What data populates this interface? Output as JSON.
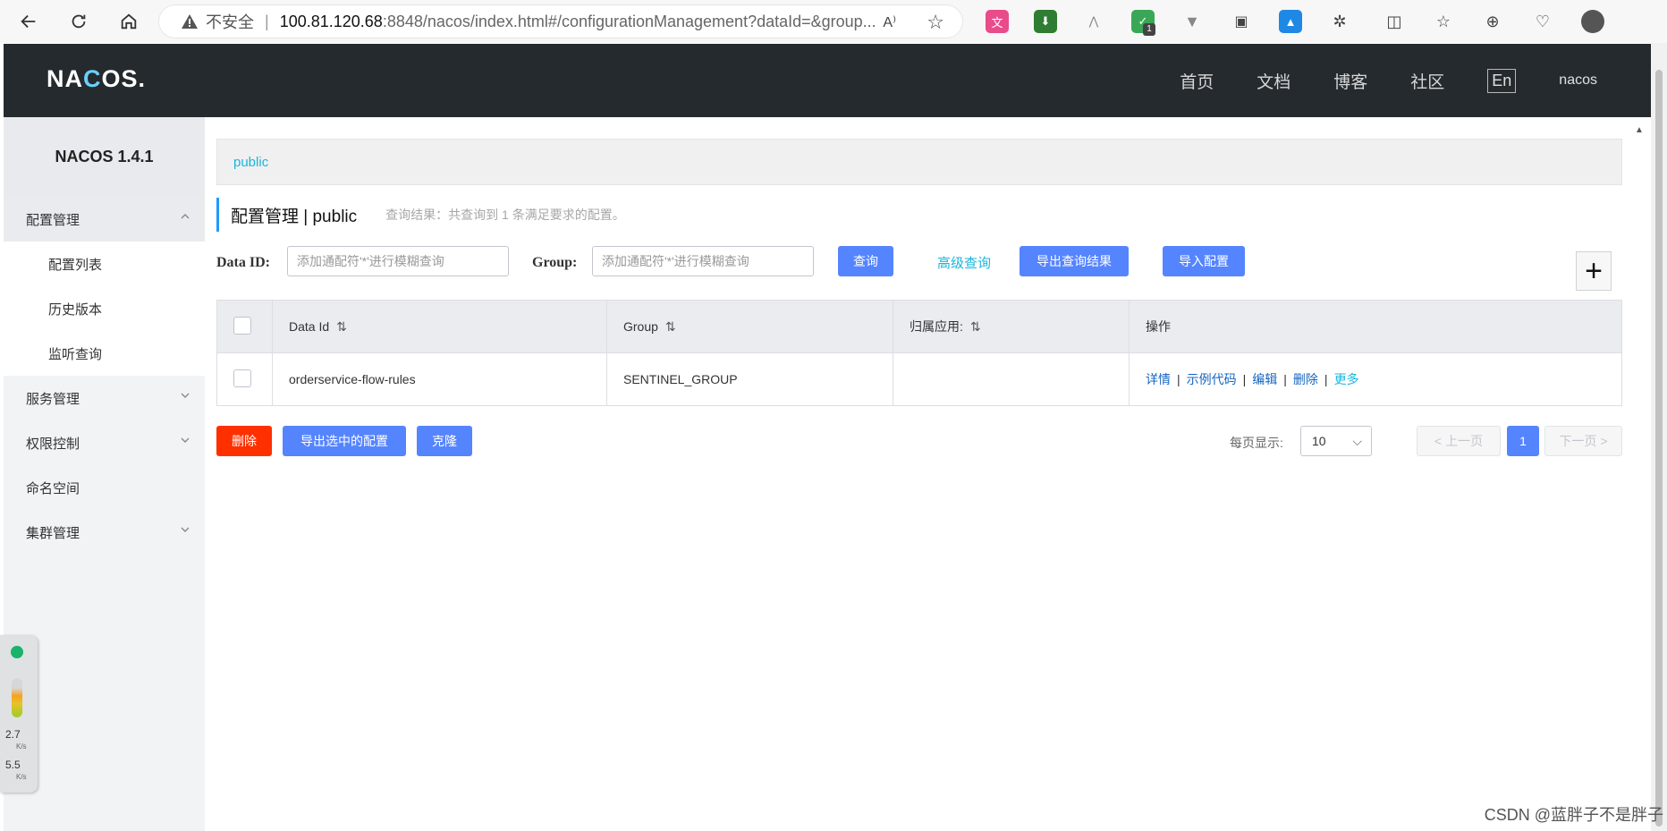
{
  "browser": {
    "insecure_label": "不安全",
    "url_host": "100.81.120.68",
    "url_rest": ":8848/nacos/index.html#/configurationManagement?dataId=&group...",
    "read_aloud": "A⁾",
    "badge": "1"
  },
  "header": {
    "logo_a": "NA",
    "logo_b": "C",
    "logo_c": "OS.",
    "nav": [
      "首页",
      "文档",
      "博客",
      "社区"
    ],
    "lang": "En",
    "user": "nacos"
  },
  "sidebar": {
    "title": "NACOS 1.4.1",
    "items": [
      {
        "label": "配置管理"
      },
      {
        "label": "配置列表"
      },
      {
        "label": "历史版本"
      },
      {
        "label": "监听查询"
      },
      {
        "label": "服务管理"
      },
      {
        "label": "权限控制"
      },
      {
        "label": "命名空间"
      },
      {
        "label": "集群管理"
      }
    ]
  },
  "net_widget": {
    "up": "2.7",
    "up_unit": "K/s",
    "down": "5.5",
    "down_unit": "K/s"
  },
  "main": {
    "namespace": "public",
    "title": "配置管理  |  public",
    "result": "查询结果：共查询到 1 条满足要求的配置。",
    "filters": {
      "data_id_label": "Data ID:",
      "data_id_placeholder": "添加通配符'*'进行模糊查询",
      "group_label": "Group:",
      "group_placeholder": "添加通配符'*'进行模糊查询",
      "query_btn": "查询",
      "advanced_link": "高级查询",
      "export_btn": "导出查询结果",
      "import_btn": "导入配置",
      "add_btn": "+"
    },
    "table": {
      "headers": [
        "Data Id",
        "Group",
        "归属应用:",
        "操作"
      ],
      "rows": [
        {
          "data_id": "orderservice-flow-rules",
          "group": "SENTINEL_GROUP",
          "app": "",
          "ops": [
            "详情",
            "示例代码",
            "编辑",
            "删除",
            "更多"
          ]
        }
      ]
    },
    "bottom": {
      "delete_btn": "删除",
      "export_selected_btn": "导出选中的配置",
      "clone_btn": "克隆",
      "per_page_label": "每页显示:",
      "per_page_value": "10",
      "prev": "上一页",
      "page": "1",
      "next": "下一页"
    }
  },
  "watermark": "CSDN @蓝胖子不是胖子"
}
